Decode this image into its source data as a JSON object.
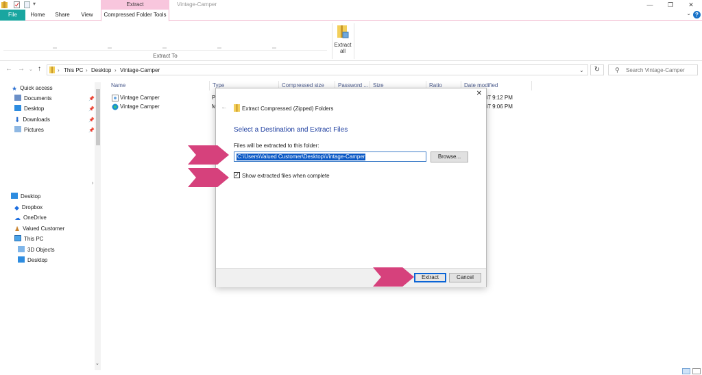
{
  "window": {
    "title": "Vintage-Camper",
    "context_group": "Extract",
    "controls": {
      "minimize": "—",
      "restore": "❐",
      "close": "✕"
    }
  },
  "ribbon": {
    "tabs": [
      "File",
      "Home",
      "Share",
      "View",
      "Compressed Folder Tools"
    ],
    "extract_to_label": "Extract To",
    "extract_all_label": [
      "Extract",
      "all"
    ],
    "help": "?"
  },
  "address_bar": {
    "crumbs": [
      "This PC",
      "Desktop",
      "Vintage-Camper"
    ],
    "search_placeholder": "Search Vintage-Camper"
  },
  "nav_pane": {
    "quick_access": "Quick access",
    "pinned": [
      "Documents",
      "Desktop",
      "Downloads",
      "Pictures"
    ],
    "tree": [
      "Desktop",
      "Dropbox",
      "OneDrive",
      "Valued Customer",
      "This PC",
      "3D Objects",
      "Desktop"
    ]
  },
  "file_list": {
    "columns": [
      "Name",
      "Type",
      "Compressed size",
      "Password ...",
      "Size",
      "Ratio",
      "Date modified"
    ],
    "rows": [
      {
        "name": "Vintage Camper",
        "type": "Ph",
        "date": "37 9:12 PM"
      },
      {
        "name": "Vintage Camper",
        "type": "M",
        "date": "37 9:06 PM"
      }
    ]
  },
  "dialog": {
    "title": "Extract Compressed (Zipped) Folders",
    "heading": "Select a Destination and Extract Files",
    "path_label": "Files will be extracted to this folder:",
    "path_value": "C:\\Users\\Valued Customer\\Desktop\\Vintage-Camper",
    "browse_label": "Browse...",
    "checkbox_label": "Show extracted files when complete",
    "checkbox_checked": true,
    "extract_label": "Extract",
    "cancel_label": "Cancel"
  },
  "colors": {
    "accent_pink": "#d6417c",
    "context_tab": "#f8c6dd",
    "file_tab": "#19a6a0",
    "selection_blue": "#0a58c5"
  }
}
